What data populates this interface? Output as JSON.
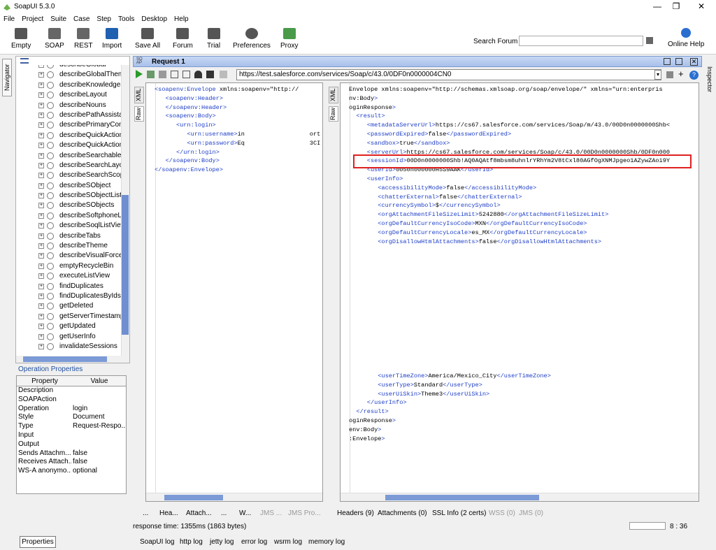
{
  "window": {
    "title": "SoapUI 5.3.0"
  },
  "menu": [
    "File",
    "Project",
    "Suite",
    "Case",
    "Step",
    "Tools",
    "Desktop",
    "Help"
  ],
  "toolbar": {
    "buttons": [
      "Empty",
      "SOAP",
      "REST",
      "Import",
      "Save All",
      "Forum",
      "Trial",
      "Preferences",
      "Proxy"
    ],
    "search_label": "Search Forum",
    "online_help": "Online Help"
  },
  "sidebar": {
    "navigator_tab": "Navigator",
    "inspector_tab": "Inspector",
    "items": [
      "describeGlobal",
      "describeGlobalThem",
      "describeKnowledgeS",
      "describeLayout",
      "describeNouns",
      "describePathAssistar",
      "describePrimaryCon",
      "describeQuickAction",
      "describeQuickAction",
      "describeSearchableE",
      "describeSearchLayou",
      "describeSearchScop",
      "describeSObject",
      "describeSObjectList",
      "describeSObjects",
      "describeSoftphoneL",
      "describeSoqlListView",
      "describeTabs",
      "describeTheme",
      "describeVisualForce",
      "emptyRecycleBin",
      "executeListView",
      "findDuplicates",
      "findDuplicatesByIds",
      "getDeleted",
      "getServerTimestamp",
      "getUpdated",
      "getUserInfo",
      "invalidateSessions"
    ]
  },
  "op_props": {
    "title": "Operation Properties",
    "headers": [
      "Property",
      "Value"
    ],
    "rows": [
      [
        "Description",
        ""
      ],
      [
        "SOAPAction",
        ""
      ],
      [
        "Operation",
        "login"
      ],
      [
        "Style",
        "Document"
      ],
      [
        "Type",
        "Request-Respo..."
      ],
      [
        "Input",
        ""
      ],
      [
        "Output",
        ""
      ],
      [
        "Sends Attachm...",
        "false"
      ],
      [
        "Receives Attach...",
        "false"
      ],
      [
        "WS-A anonymo...",
        "optional"
      ]
    ],
    "button": "Properties"
  },
  "request": {
    "title": "Request 1",
    "url": "https://test.salesforce.com/services/Soap/c/43.0/0DF0n0000004CN0",
    "xml_tab": "XML",
    "raw_tab": "Raw",
    "lines": [
      "<soapenv:Envelope xmlns:soapenv=\"http://",
      "   <soapenv:Header>",
      "   </soapenv:Header>",
      "   <soapenv:Body>",
      "      <urn:login>",
      "         <urn:username>in                  ort",
      "         <urn:password>Eq                  3CI",
      "      </urn:login>",
      "   </soapenv:Body>",
      "</soapenv:Envelope>"
    ]
  },
  "response": {
    "xml_tab": "XML",
    "raw_tab": "Raw",
    "lines": [
      "Envelope xmlns:soapenv=\"http://schemas.xmlsoap.org/soap/envelope/\" xmlns=\"urn:enterpris",
      "nv:Body>",
      "oginResponse>",
      "  <result>",
      "     <metadataServerUrl>https://cs67.salesforce.com/services/Soap/m/43.0/00D0n0000000Shb<",
      "     <passwordExpired>false</passwordExpired>",
      "     <sandbox>true</sandbox>",
      "     <serverUrl>https://cs67.salesforce.com/services/Soap/c/43.0/00D0n0000000Shb/0DF0n000",
      "     <sessionId>00D0n0000000Shb!AQ0AQAtf8mbsm8uhnlrYRhYm2V8tCxl80AGfOgXNMJpgeo1AZywZAoi9Y",
      "     <userId>0050n000000H5S9AAK</userId>",
      "     <userInfo>",
      "        <accessibilityMode>false</accessibilityMode>",
      "        <chatterExternal>false</chatterExternal>",
      "        <currencySymbol>$</currencySymbol>",
      "        <orgAttachmentFileSizeLimit>5242880</orgAttachmentFileSizeLimit>",
      "        <orgDefaultCurrencyIsoCode>MXN</orgDefaultCurrencyIsoCode>",
      "        <orgDefaultCurrencyLocale>es_MX</orgDefaultCurrencyLocale>",
      "        <orgDisallowHtmlAttachments>false</orgDisallowHtmlAttachments>"
    ],
    "lines2": [
      "        <userTimeZone>America/Mexico_City</userTimeZone>",
      "        <userType>Standard</userType>",
      "        <userUiSkin>Theme3</userUiSkin>",
      "     </userInfo>",
      "  </result>",
      "oginResponse>",
      "env:Body>",
      ":Envelope>"
    ]
  },
  "bottom_tabs_left": [
    "...",
    "Hea...",
    "Attach...",
    "...",
    "W...",
    "JMS ...",
    "JMS Pro..."
  ],
  "bottom_tabs_right": [
    "Headers (9)",
    "Attachments (0)",
    "SSL Info (2 certs)",
    "WSS (0)",
    "JMS (0)"
  ],
  "status": {
    "response_time": "response time: 1355ms (1863 bytes)",
    "cursor": "8 : 36"
  },
  "log_tabs": [
    "SoapUI log",
    "http log",
    "jetty log",
    "error log",
    "wsrm log",
    "memory log"
  ]
}
